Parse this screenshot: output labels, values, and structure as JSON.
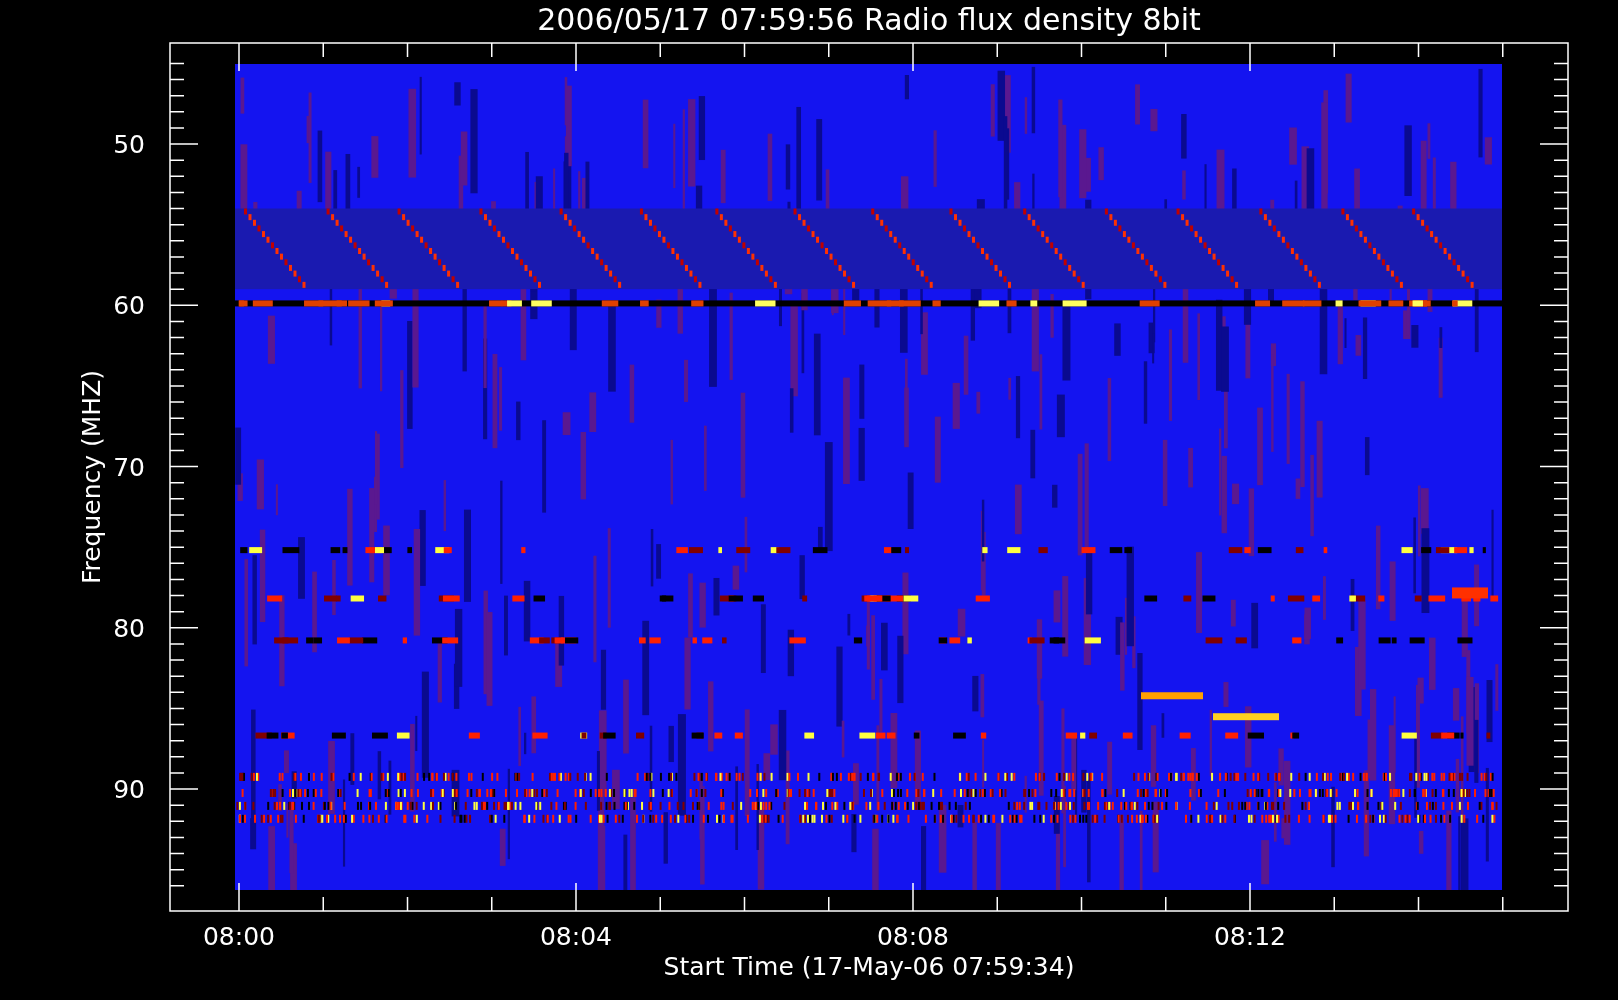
{
  "plot": {
    "title": "2006/05/17 07:59:56 Radio flux density 8bit",
    "xlabel": "Start Time (17-May-06 07:59:34)",
    "ylabel": "Frequency (MHZ)",
    "xtick_labels": [
      "08:00",
      "08:04",
      "08:08",
      "08:12"
    ],
    "ytick_labels": [
      "50",
      "60",
      "70",
      "80",
      "90"
    ]
  }
}
